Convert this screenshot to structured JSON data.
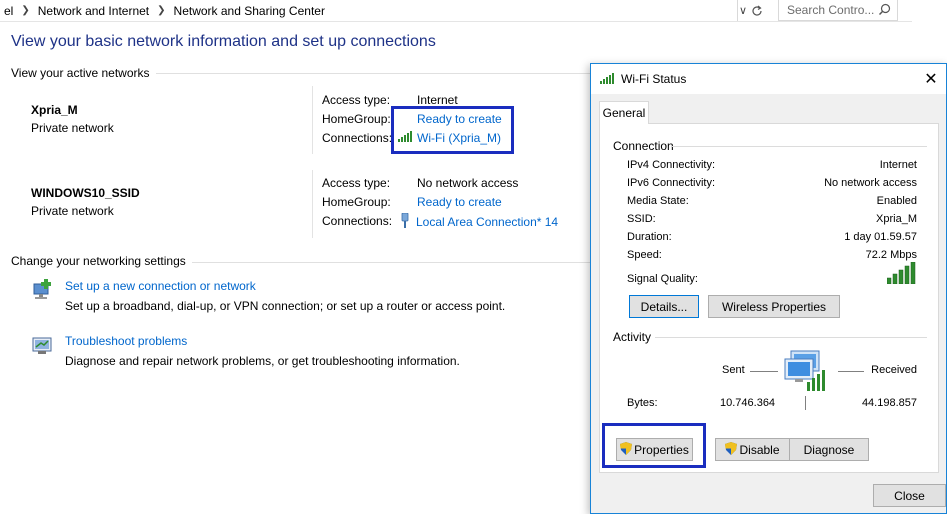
{
  "addressbar": {
    "crumbs": [
      "el",
      "Network and Internet",
      "Network and Sharing Center"
    ],
    "search_placeholder": "Search Contro..."
  },
  "main": {
    "title": "View your basic network information and set up connections",
    "active_networks_heading": "View your active networks",
    "networks": [
      {
        "name": "Xpria_M",
        "category": "Private network",
        "access_type_label": "Access type:",
        "access_type": "Internet",
        "homegroup_label": "HomeGroup:",
        "homegroup": "Ready to create",
        "connections_label": "Connections:",
        "connection": "Wi-Fi (Xpria_M)"
      },
      {
        "name": "WINDOWS10_SSID",
        "category": "Private network",
        "access_type_label": "Access type:",
        "access_type": "No network access",
        "homegroup_label": "HomeGroup:",
        "homegroup": "Ready to create",
        "connections_label": "Connections:",
        "connection": "Local Area Connection* 14"
      }
    ],
    "settings_heading": "Change your networking settings",
    "tasks": [
      {
        "title": "Set up a new connection or network",
        "desc": "Set up a broadband, dial-up, or VPN connection; or set up a router or access point."
      },
      {
        "title": "Troubleshoot problems",
        "desc": "Diagnose and repair network problems, or get troubleshooting information."
      }
    ]
  },
  "dialog": {
    "title": "Wi-Fi Status",
    "tab": "General",
    "connection_heading": "Connection",
    "rows": [
      {
        "label": "IPv4 Connectivity:",
        "value": "Internet"
      },
      {
        "label": "IPv6 Connectivity:",
        "value": "No network access"
      },
      {
        "label": "Media State:",
        "value": "Enabled"
      },
      {
        "label": "SSID:",
        "value": "Xpria_M"
      },
      {
        "label": "Duration:",
        "value": "1 day 01.59.57"
      },
      {
        "label": "Speed:",
        "value": "72.2 Mbps"
      }
    ],
    "signal_quality_label": "Signal Quality:",
    "signal_bars": 5,
    "details_button": "Details...",
    "wireless_properties_button": "Wireless Properties",
    "activity_heading": "Activity",
    "sent_label": "Sent",
    "received_label": "Received",
    "bytes_label": "Bytes:",
    "bytes_sent": "10.746.364",
    "bytes_received": "44.198.857",
    "properties_button": "Properties",
    "disable_button": "Disable",
    "diagnose_button": "Diagnose",
    "close_button": "Close",
    "close_icon_glyph": "✕"
  },
  "colors": {
    "title_blue": "#1e3287",
    "link_blue": "#0066cc",
    "highlight_blue": "#1a2dbf",
    "signal_green": "#2e8b2e"
  }
}
